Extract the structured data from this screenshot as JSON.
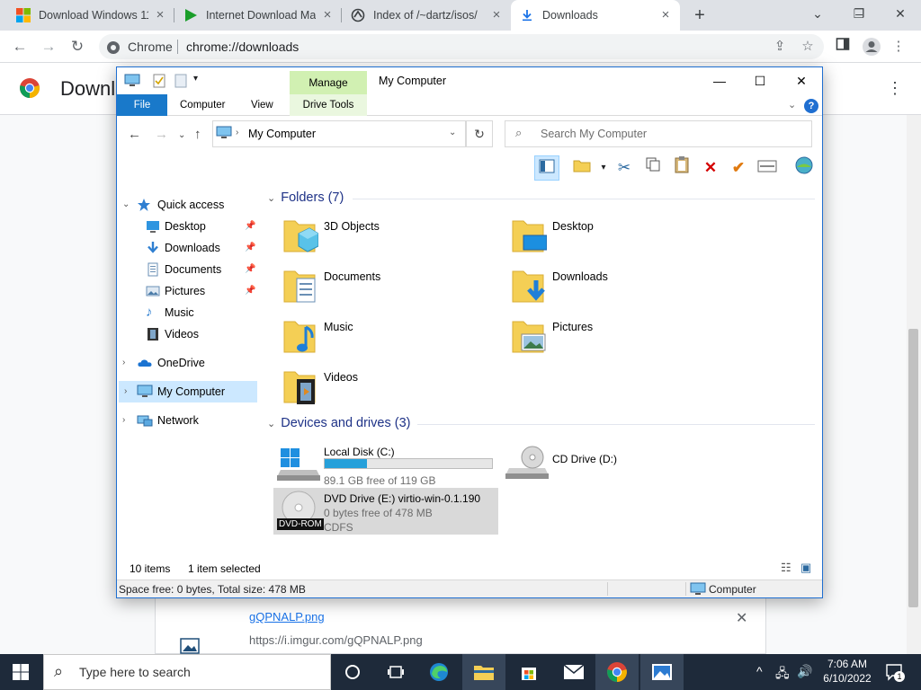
{
  "chrome": {
    "tabs": [
      {
        "title": "Download Windows 11",
        "icon": "windows-logo-icon"
      },
      {
        "title": "Internet Download Ma",
        "icon": "play-icon"
      },
      {
        "title": "Index of /~dartz/isos/",
        "icon": "apache-icon"
      },
      {
        "title": "Downloads",
        "icon": "download-icon"
      }
    ],
    "site_name": "Chrome",
    "url": "chrome://downloads",
    "page_title": "Downloads",
    "download_item": {
      "name": "gQPNALP.png",
      "url": "https://i.imgur.com/gQPNALP.png"
    }
  },
  "explorer": {
    "title": "My Computer",
    "manage_label": "Manage",
    "ribbon_tabs": [
      "File",
      "Computer",
      "View",
      "Drive Tools"
    ],
    "address": "My Computer",
    "search_placeholder": "Search My Computer",
    "nav": {
      "quick_access": "Quick access",
      "quick_items": [
        "Desktop",
        "Downloads",
        "Documents",
        "Pictures",
        "Music",
        "Videos"
      ],
      "onedrive": "OneDrive",
      "my_computer": "My Computer",
      "network": "Network"
    },
    "folders_header": "Folders (7)",
    "folders": [
      "3D Objects",
      "Desktop",
      "Documents",
      "Downloads",
      "Music",
      "Pictures",
      "Videos"
    ],
    "devices_header": "Devices and drives (3)",
    "drives": [
      {
        "name": "Local Disk (C:)",
        "free": "89.1 GB free of 119 GB",
        "used_fraction": 0.25
      },
      {
        "name": "CD Drive (D:)"
      },
      {
        "name": "DVD Drive (E:) virtio-win-0.1.190",
        "free": "0 bytes free of 478 MB",
        "fs": "CDFS",
        "badge": "DVD-ROM"
      }
    ],
    "status": {
      "items": "10 items",
      "selected": "1 item selected"
    },
    "bottom_status": {
      "space": "Space free: 0 bytes, Total size: 478 MB",
      "location": "Computer"
    }
  },
  "taskbar": {
    "search_placeholder": "Type here to search",
    "time": "7:06 AM",
    "date": "6/10/2022",
    "notifications": "1"
  }
}
